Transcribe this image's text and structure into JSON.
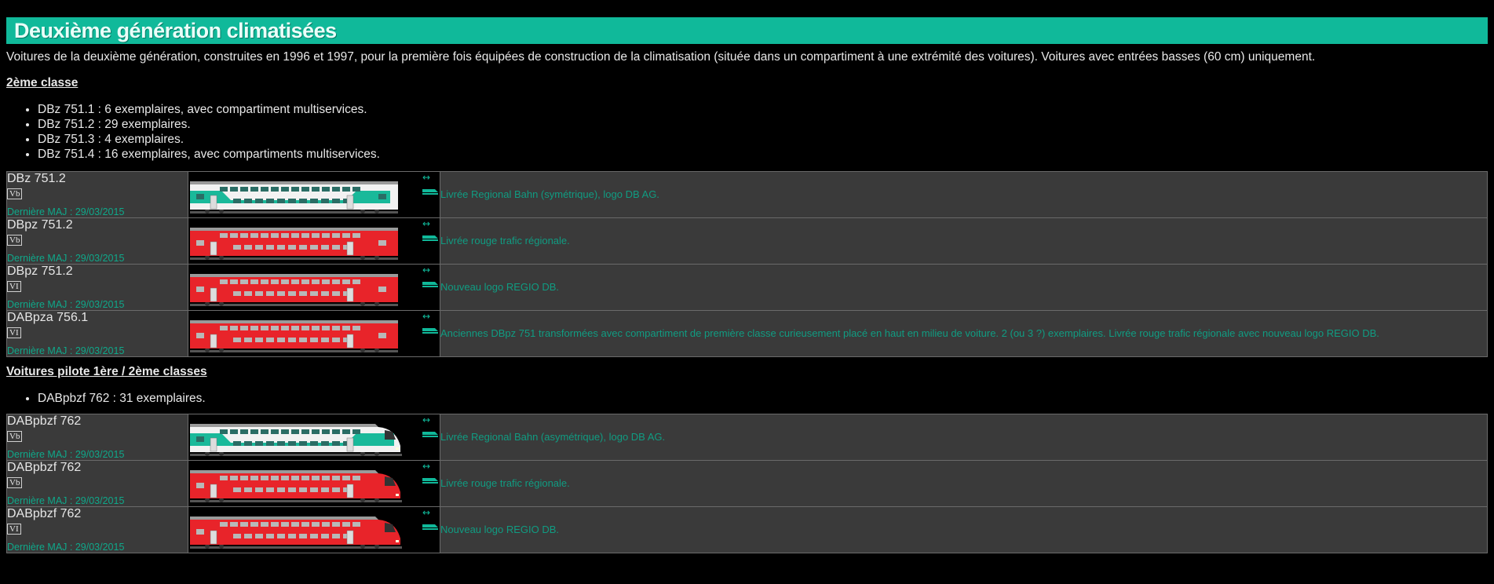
{
  "banner": {
    "title": "Deuxième génération climatisées"
  },
  "intro": "Voitures de la deuxième génération, construites en 1996 et 1997, pour la première fois équipées de construction de la climatisation (située dans un compartiment à une extrémité des voitures). Voitures avec entrées basses (60 cm) uniquement.",
  "section1": {
    "title": "2ème classe",
    "items": [
      "DBz 751.1 : 6 exemplaires, avec compartiment multiservices.",
      "DBz 751.2 : 29 exemplaires.",
      "DBz 751.3 : 4 exemplaires.",
      "DBz 751.4 : 16 exemplaires, avec compartiments multiservices."
    ],
    "rows": [
      {
        "name": "DBz 751.2",
        "epoch": "Vb",
        "maj": "Dernière MAJ : 29/03/2015",
        "desc": "Livrée Regional Bahn (symétrique), logo DB AG.",
        "livery": "green",
        "type": "mid"
      },
      {
        "name": "DBpz 751.2",
        "epoch": "Vb",
        "maj": "Dernière MAJ : 29/03/2015",
        "desc": "Livrée rouge trafic régionale.",
        "livery": "red",
        "type": "mid"
      },
      {
        "name": "DBpz 751.2",
        "epoch": "VI",
        "maj": "Dernière MAJ : 29/03/2015",
        "desc": "Nouveau logo REGIO DB.",
        "livery": "red",
        "type": "mid"
      },
      {
        "name": "DABpza 756.1",
        "epoch": "VI",
        "maj": "Dernière MAJ : 29/03/2015",
        "desc": "Anciennes DBpz 751 transformées avec compartiment de première classe curieusement placé en haut en milieu de voiture. 2 (ou 3 ?) exemplaires. Livrée rouge trafic régionale avec nouveau logo REGIO DB.",
        "livery": "red",
        "type": "mid"
      }
    ]
  },
  "section2": {
    "title": "Voitures pilote 1ère / 2ème classes",
    "items": [
      "DABpbzf 762 : 31 exemplaires."
    ],
    "rows": [
      {
        "name": "DABpbzf 762",
        "epoch": "Vb",
        "maj": "Dernière MAJ : 29/03/2015",
        "desc": "Livrée Regional Bahn (asymétrique), logo DB AG.",
        "livery": "green",
        "type": "cab"
      },
      {
        "name": "DABpbzf 762",
        "epoch": "Vb",
        "maj": "Dernière MAJ : 29/03/2015",
        "desc": "Livrée rouge trafic régionale.",
        "livery": "red",
        "type": "cab"
      },
      {
        "name": "DABpbzf 762",
        "epoch": "VI",
        "maj": "Dernière MAJ : 29/03/2015",
        "desc": "Nouveau logo REGIO DB.",
        "livery": "red",
        "type": "cab"
      }
    ]
  },
  "colors": {
    "accent": "#10b99a",
    "desc_text": "#109c82",
    "red_livery": "#e8242a",
    "green_livery": "#19b99a"
  }
}
